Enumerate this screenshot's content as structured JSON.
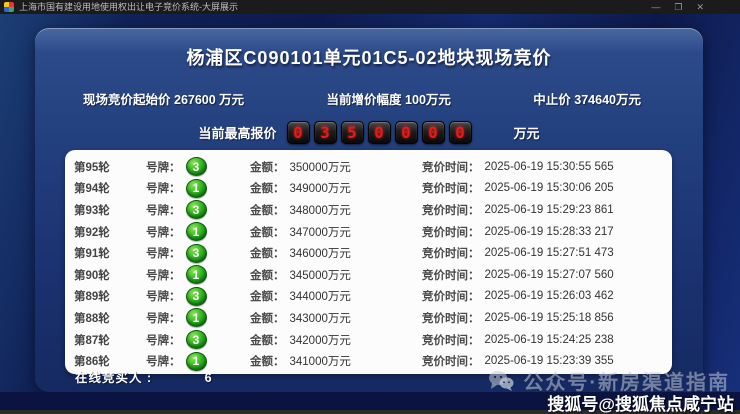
{
  "window": {
    "title": "上海市国有建设用地使用权出让电子竞价系统-大屏展示",
    "minimize": "—",
    "maximize": "❐",
    "close": "✕"
  },
  "auction": {
    "title": "杨浦区C090101单元01C5-02地块现场竞价",
    "start_price_label": "现场竞价起始价",
    "start_price_value": "267600 万元",
    "increment_label": "当前增价幅度",
    "increment_value": "100万元",
    "stop_price_label": "中止价",
    "stop_price_value": "374640万元",
    "highest_bid_label": "当前最高报价",
    "highest_bid_digits": [
      "0",
      "3",
      "5",
      "0",
      "0",
      "0",
      "0"
    ],
    "highest_bid_unit": "万元"
  },
  "table": {
    "paddle_label": "号牌：",
    "amount_label": "金额：",
    "time_label": "竞价时间：",
    "rows": [
      {
        "round": "第95轮",
        "paddle": "3",
        "amount": "350000万元",
        "time": "2025-06-19 15:30:55 565"
      },
      {
        "round": "第94轮",
        "paddle": "1",
        "amount": "349000万元",
        "time": "2025-06-19 15:30:06 205"
      },
      {
        "round": "第93轮",
        "paddle": "3",
        "amount": "348000万元",
        "time": "2025-06-19 15:29:23 861"
      },
      {
        "round": "第92轮",
        "paddle": "1",
        "amount": "347000万元",
        "time": "2025-06-19 15:28:33 217"
      },
      {
        "round": "第91轮",
        "paddle": "3",
        "amount": "346000万元",
        "time": "2025-06-19 15:27:51 473"
      },
      {
        "round": "第90轮",
        "paddle": "1",
        "amount": "345000万元",
        "time": "2025-06-19 15:27:07 560"
      },
      {
        "round": "第89轮",
        "paddle": "3",
        "amount": "344000万元",
        "time": "2025-06-19 15:26:03 462"
      },
      {
        "round": "第88轮",
        "paddle": "1",
        "amount": "343000万元",
        "time": "2025-06-19 15:25:18 856"
      },
      {
        "round": "第87轮",
        "paddle": "3",
        "amount": "342000万元",
        "time": "2025-06-19 15:24:25 238"
      },
      {
        "round": "第86轮",
        "paddle": "1",
        "amount": "341000万元",
        "time": "2025-06-19 15:23:39 355"
      }
    ]
  },
  "footer": {
    "online_label": "在线竞买人 :",
    "online_value": "6"
  },
  "watermarks": {
    "wechat": "公众号·新房渠道指南",
    "sohu": "搜狐号@搜狐焦点咸宁站"
  },
  "colors": {
    "digit_red": "#e31b1b",
    "badge_green": "#128a12",
    "panel_blue": "#23407e"
  }
}
